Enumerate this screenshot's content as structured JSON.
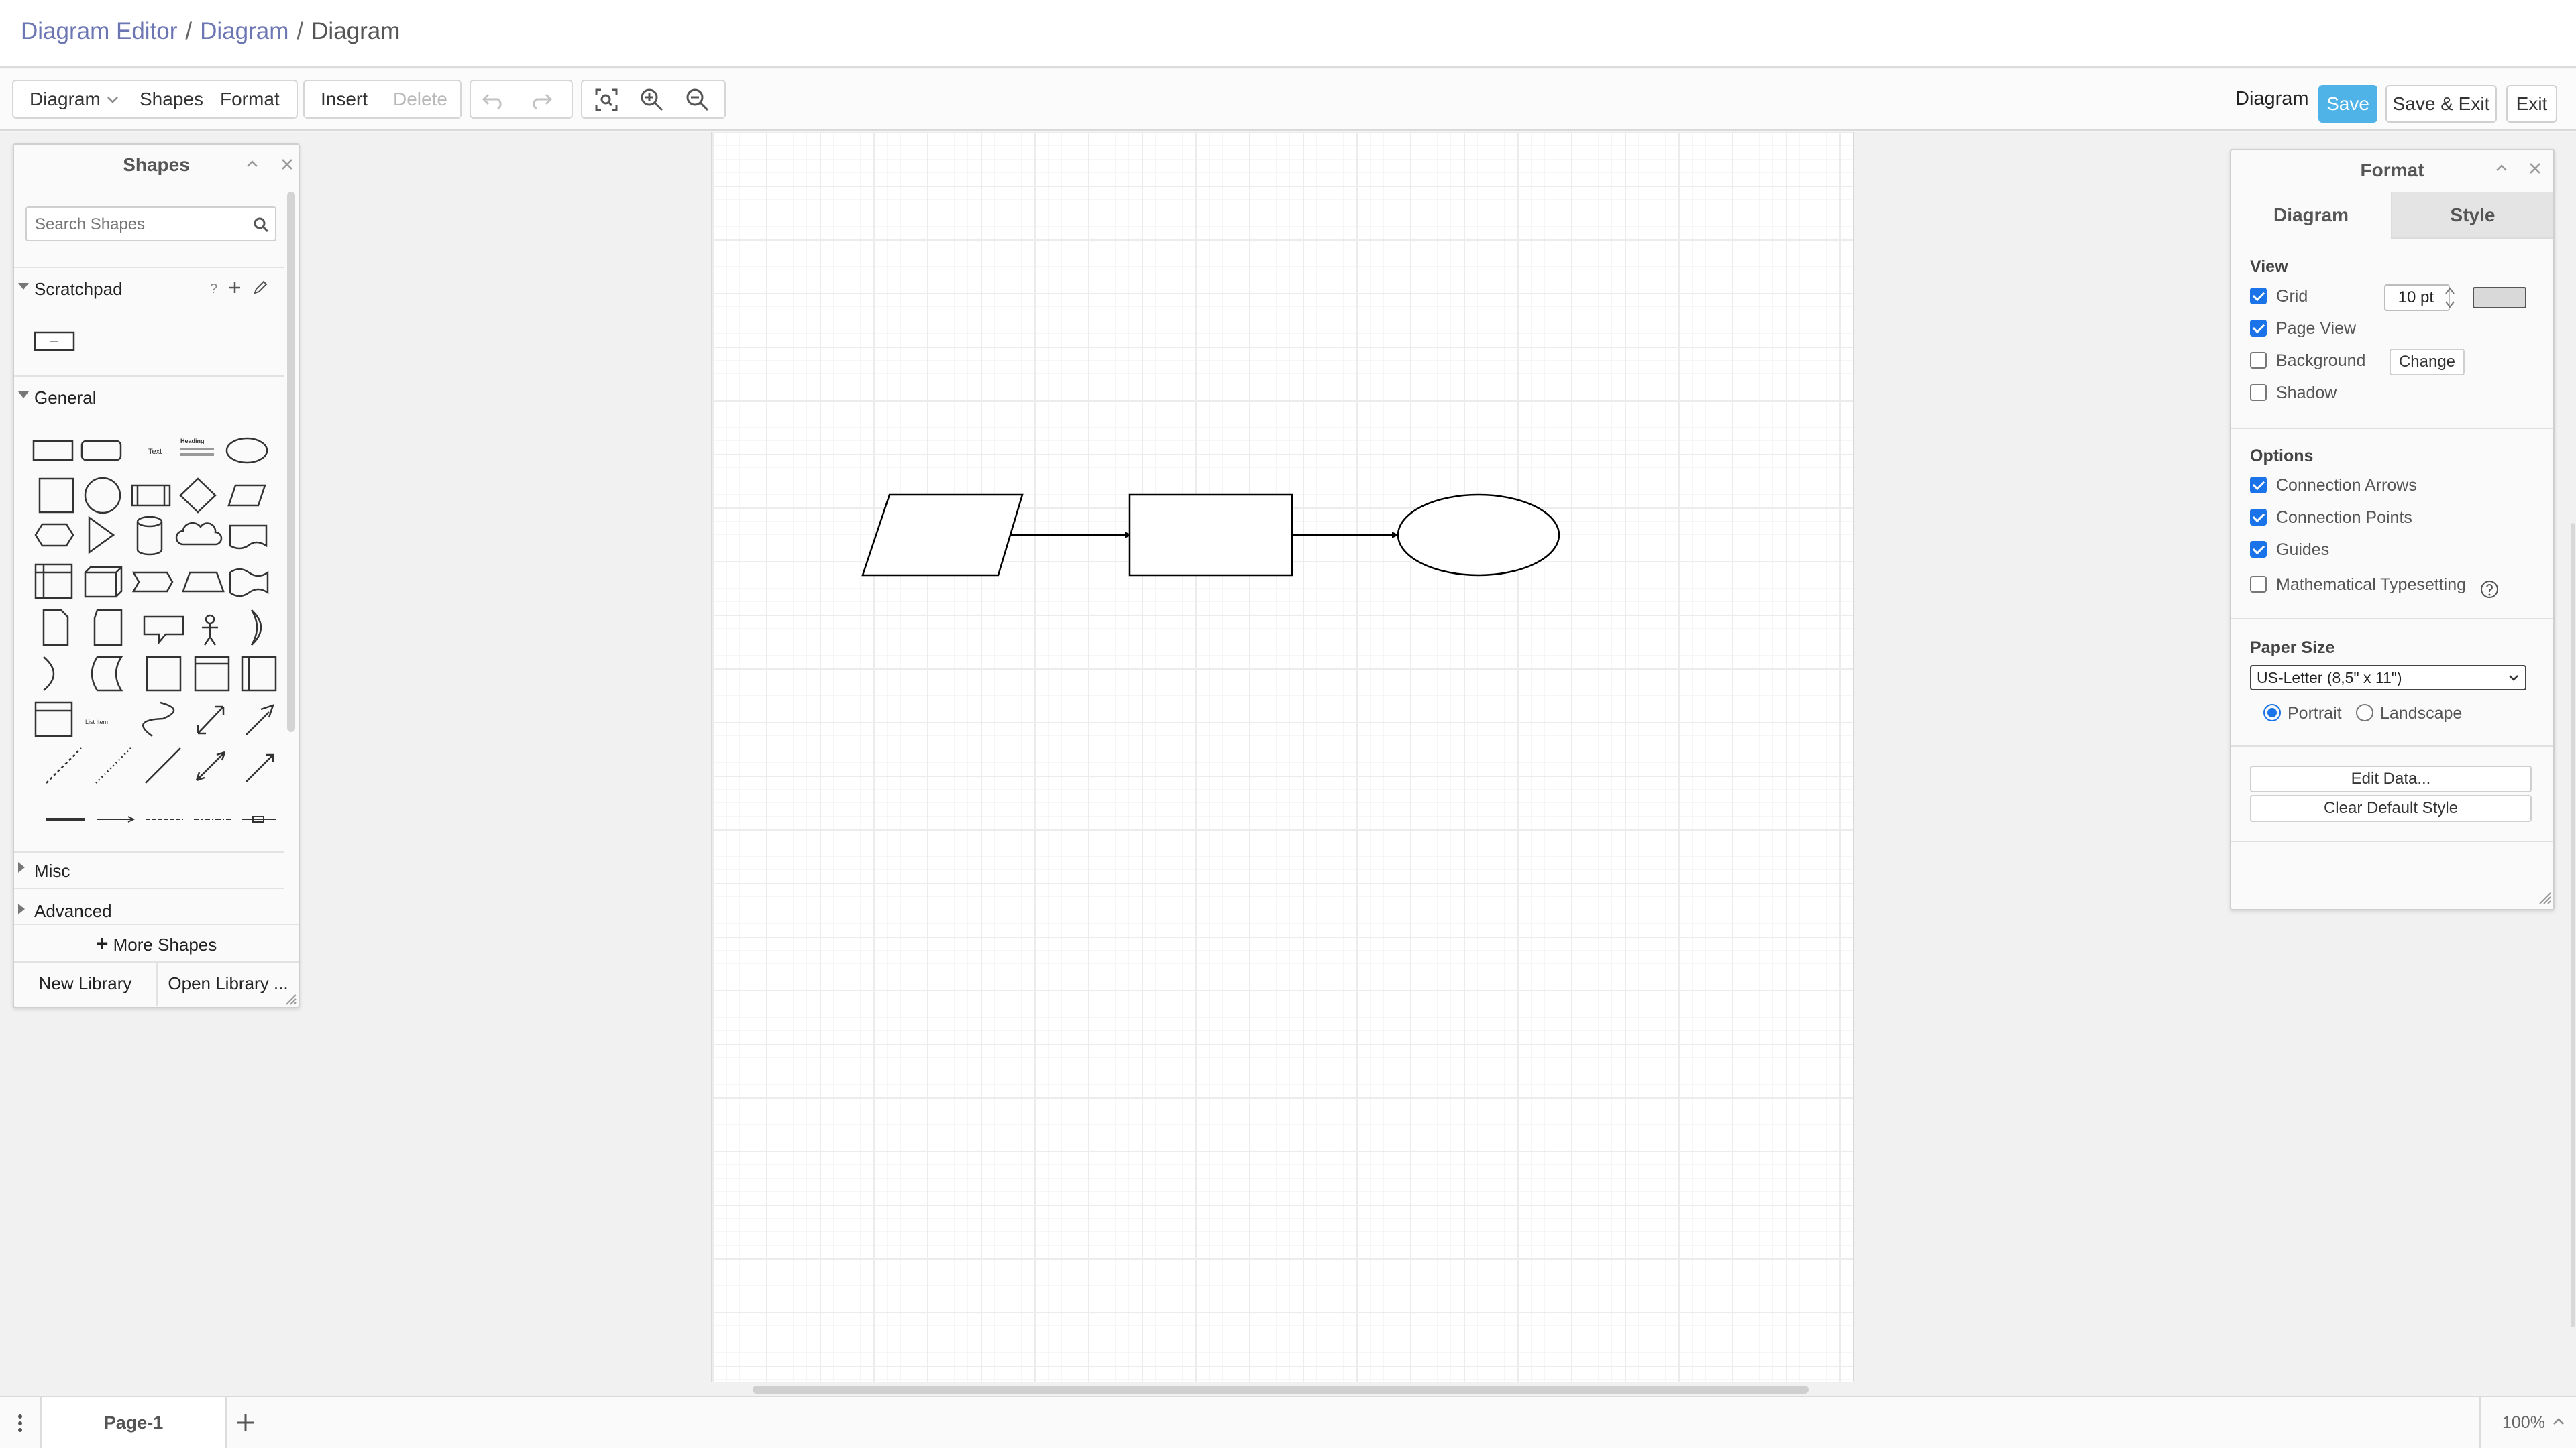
{
  "breadcrumb": {
    "root": "Diagram Editor",
    "sep": "/",
    "middle": "Diagram",
    "current": "Diagram"
  },
  "toolbar": {
    "diagram_menu": "Diagram",
    "shapes": "Shapes",
    "format": "Format",
    "insert": "Insert",
    "delete": "Delete",
    "right_label": "Diagram",
    "save": "Save",
    "save_exit": "Save & Exit",
    "exit": "Exit"
  },
  "shapes_panel": {
    "title": "Shapes",
    "search_placeholder": "Search Shapes",
    "scratchpad": "Scratchpad",
    "scratchpad_help": "?",
    "general": "General",
    "misc": "Misc",
    "advanced": "Advanced",
    "more_shapes": "More Shapes",
    "new_library": "New Library",
    "open_library": "Open Library ...",
    "mini_labels": {
      "text": "Text",
      "heading": "Heading",
      "list_item": "List Item"
    }
  },
  "format_panel": {
    "title": "Format",
    "tabs": [
      "Diagram",
      "Style"
    ],
    "view_title": "View",
    "view": [
      {
        "label": "Grid",
        "checked": true
      },
      {
        "label": "Page View",
        "checked": true
      },
      {
        "label": "Background",
        "checked": false
      },
      {
        "label": "Shadow",
        "checked": false
      }
    ],
    "grid_size": "10 pt",
    "grid_color": "#d9d9d9",
    "change_btn": "Change",
    "options_title": "Options",
    "options": [
      {
        "label": "Connection Arrows",
        "checked": true
      },
      {
        "label": "Connection Points",
        "checked": true
      },
      {
        "label": "Guides",
        "checked": true
      },
      {
        "label": "Mathematical Typesetting",
        "checked": false
      }
    ],
    "paper_title": "Paper Size",
    "paper_size": "US-Letter (8,5\" x 11\")",
    "orientation": [
      {
        "label": "Portrait",
        "selected": true
      },
      {
        "label": "Landscape",
        "selected": false
      }
    ],
    "edit_data": "Edit Data...",
    "clear_style": "Clear Default Style"
  },
  "bottom": {
    "page_tab": "Page-1",
    "zoom": "100%"
  },
  "colors": {
    "accent": "#4fb3e8",
    "checkbox": "#1a73e8",
    "link": "#6b76b3"
  }
}
